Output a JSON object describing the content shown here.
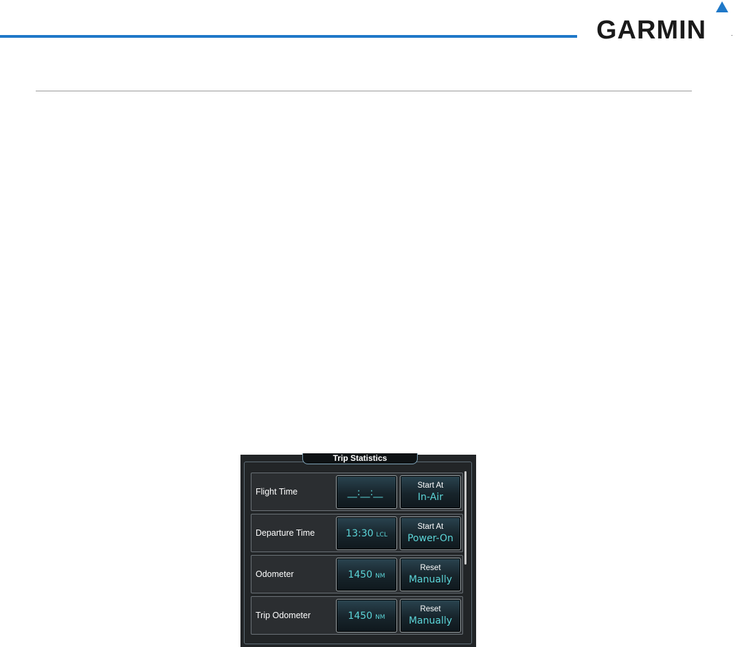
{
  "brand": {
    "name": "GARMIN",
    "registered": ".",
    "accent_color": "#1f78c8"
  },
  "panel": {
    "title": "Trip Statistics",
    "rows": [
      {
        "label": "Flight Time",
        "value": "__:__:__",
        "unit": "",
        "mode_top": "Start At",
        "mode_bottom": "In-Air"
      },
      {
        "label": "Departure Time",
        "value": "13:30",
        "unit": "LCL",
        "mode_top": "Start At",
        "mode_bottom": "Power-On"
      },
      {
        "label": "Odometer",
        "value": "1450",
        "unit": "NM",
        "mode_top": "Reset",
        "mode_bottom": "Manually"
      },
      {
        "label": "Trip Odometer",
        "value": "1450",
        "unit": "NM",
        "mode_top": "Reset",
        "mode_bottom": "Manually"
      }
    ],
    "colors": {
      "value_text": "#5cd5d8",
      "label_text": "#ffffff",
      "background": "#222527"
    }
  }
}
